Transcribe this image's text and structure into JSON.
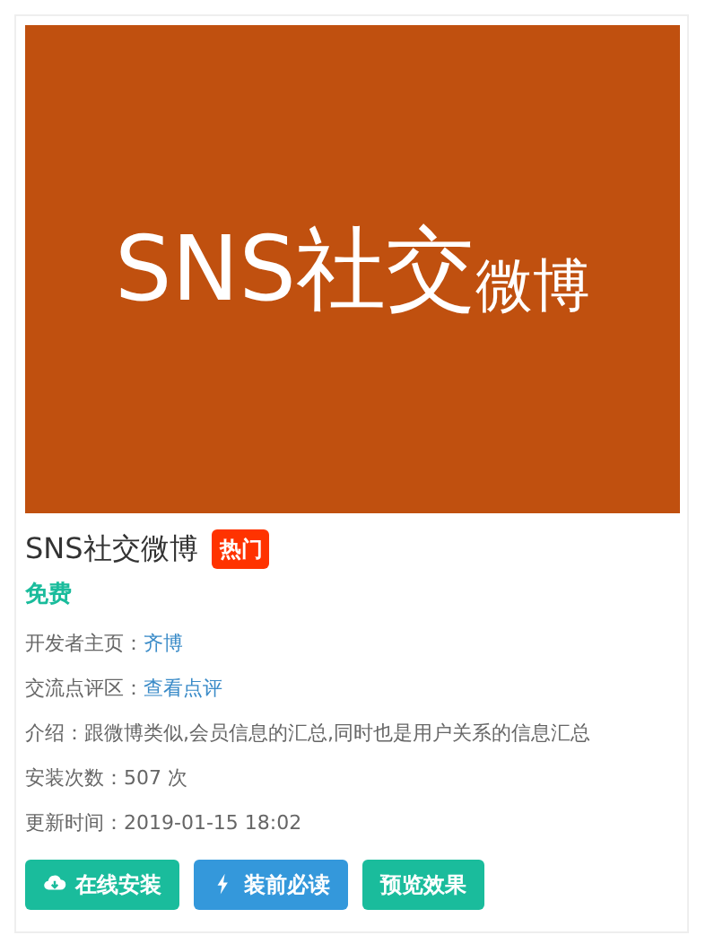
{
  "banner": {
    "text": "SNS社交",
    "small_text": "微博"
  },
  "app": {
    "title": "SNS社交微博",
    "badge": "热门",
    "price": "免费"
  },
  "info": [
    {
      "kind": "link",
      "label": "开发者主页：",
      "value": "齐博"
    },
    {
      "kind": "link",
      "label": "交流点评区：",
      "value": "查看点评"
    },
    {
      "kind": "text",
      "label": "介绍：",
      "value": "跟微博类似,会员信息的汇总,同时也是用户关系的信息汇总"
    },
    {
      "kind": "text",
      "label": "安装次数：",
      "value": "507 次"
    },
    {
      "kind": "text",
      "label": "更新时间：",
      "value": "2019-01-15 18:02"
    }
  ],
  "buttons": [
    {
      "label": "在线安装",
      "kind": "install",
      "color": "#1abc9c"
    },
    {
      "label": "装前必读",
      "kind": "notice",
      "color": "#3498db"
    },
    {
      "label": "预览效果",
      "kind": "preview",
      "color": "#1abc9c"
    }
  ]
}
